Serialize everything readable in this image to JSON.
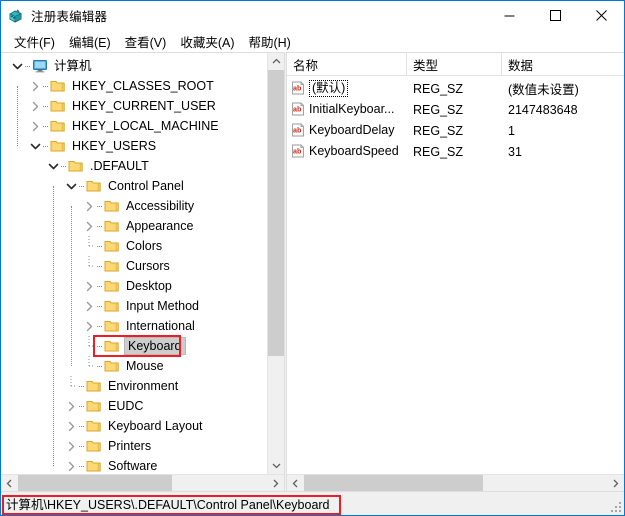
{
  "window": {
    "title": "注册表编辑器",
    "icon": "registry-editor-icon",
    "border_color": "#0078d7",
    "controls": {
      "minimize": "minimize-icon",
      "maximize": "maximize-icon",
      "close": "close-icon"
    }
  },
  "menubar": {
    "items": [
      {
        "label": "文件(F)"
      },
      {
        "label": "编辑(E)"
      },
      {
        "label": "查看(V)"
      },
      {
        "label": "收藏夹(A)"
      },
      {
        "label": "帮助(H)"
      }
    ]
  },
  "tree": {
    "nodes": [
      {
        "label": "计算机",
        "depth": 0,
        "state": "expanded",
        "icon": "computer-icon",
        "selected": false
      },
      {
        "label": "HKEY_CLASSES_ROOT",
        "depth": 1,
        "state": "collapsed",
        "icon": "folder-icon",
        "selected": false
      },
      {
        "label": "HKEY_CURRENT_USER",
        "depth": 1,
        "state": "collapsed",
        "icon": "folder-icon",
        "selected": false
      },
      {
        "label": "HKEY_LOCAL_MACHINE",
        "depth": 1,
        "state": "collapsed",
        "icon": "folder-icon",
        "selected": false
      },
      {
        "label": "HKEY_USERS",
        "depth": 1,
        "state": "expanded",
        "icon": "folder-icon",
        "selected": false
      },
      {
        "label": ".DEFAULT",
        "depth": 2,
        "state": "expanded",
        "icon": "folder-icon",
        "selected": false
      },
      {
        "label": "Control Panel",
        "depth": 3,
        "state": "expanded",
        "icon": "folder-icon",
        "selected": false
      },
      {
        "label": "Accessibility",
        "depth": 4,
        "state": "collapsed",
        "icon": "folder-icon",
        "selected": false
      },
      {
        "label": "Appearance",
        "depth": 4,
        "state": "collapsed",
        "icon": "folder-icon",
        "selected": false
      },
      {
        "label": "Colors",
        "depth": 4,
        "state": "leaf",
        "icon": "folder-icon",
        "selected": false
      },
      {
        "label": "Cursors",
        "depth": 4,
        "state": "leaf",
        "icon": "folder-icon",
        "selected": false
      },
      {
        "label": "Desktop",
        "depth": 4,
        "state": "collapsed",
        "icon": "folder-icon",
        "selected": false
      },
      {
        "label": "Input Method",
        "depth": 4,
        "state": "collapsed",
        "icon": "folder-icon",
        "selected": false
      },
      {
        "label": "International",
        "depth": 4,
        "state": "collapsed",
        "icon": "folder-icon",
        "selected": false
      },
      {
        "label": "Keyboard",
        "depth": 4,
        "state": "leaf",
        "icon": "folder-icon",
        "selected": true
      },
      {
        "label": "Mouse",
        "depth": 4,
        "state": "leaf",
        "icon": "folder-icon",
        "selected": false
      },
      {
        "label": "Environment",
        "depth": 3,
        "state": "leaf",
        "icon": "folder-icon",
        "selected": false
      },
      {
        "label": "EUDC",
        "depth": 3,
        "state": "collapsed",
        "icon": "folder-icon",
        "selected": false
      },
      {
        "label": "Keyboard Layout",
        "depth": 3,
        "state": "collapsed",
        "icon": "folder-icon",
        "selected": false
      },
      {
        "label": "Printers",
        "depth": 3,
        "state": "collapsed",
        "icon": "folder-icon",
        "selected": false
      },
      {
        "label": "Software",
        "depth": 3,
        "state": "collapsed",
        "icon": "folder-icon",
        "selected": false
      }
    ]
  },
  "list": {
    "columns": [
      {
        "label": "名称"
      },
      {
        "label": "类型"
      },
      {
        "label": "数据"
      }
    ],
    "rows": [
      {
        "name": "(默认)",
        "type": "REG_SZ",
        "data": "(数值未设置)",
        "icon": "string-value-icon"
      },
      {
        "name": "InitialKeyboar...",
        "type": "REG_SZ",
        "data": "2147483648",
        "icon": "string-value-icon"
      },
      {
        "name": "KeyboardDelay",
        "type": "REG_SZ",
        "data": "1",
        "icon": "string-value-icon"
      },
      {
        "name": "KeyboardSpeed",
        "type": "REG_SZ",
        "data": "31",
        "icon": "string-value-icon"
      }
    ]
  },
  "statusbar": {
    "path": "计算机\\HKEY_USERS\\.DEFAULT\\Control Panel\\Keyboard"
  },
  "annotations": {
    "color": "#ee1d24",
    "keyboard_highlight": "Keyboard",
    "status_highlight": "计算机\\HKEY_USERS\\.DEFAULT\\Control Panel\\Keyboard"
  }
}
